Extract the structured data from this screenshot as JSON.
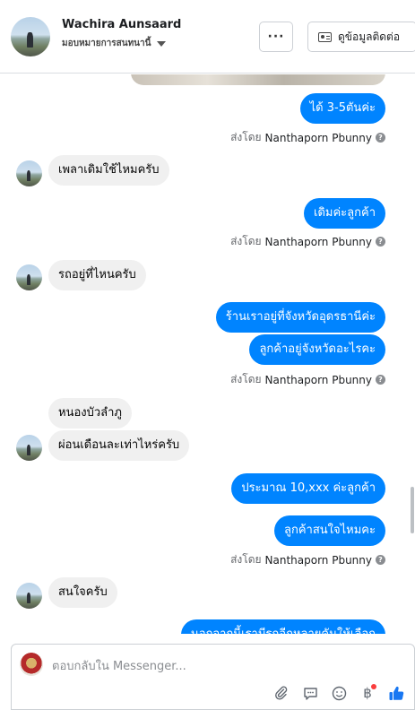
{
  "header": {
    "name": "Wachira Aunsaard",
    "assign_label": "มอบหมายการสนทนานี้",
    "more_label": "···",
    "contact_button": "ดูข้อมูลติดต่อ"
  },
  "messages": [
    {
      "type": "out",
      "text": "ได้ 3-5ตันค่ะ"
    },
    {
      "type": "in",
      "text": "เพลาเดิมใช้ไหมครับ"
    },
    {
      "type": "out",
      "text": "เดิมค่ะลูกค้า"
    },
    {
      "type": "in",
      "text": "รถอยู่ที่ไหนครับ"
    },
    {
      "type": "out",
      "text": "ร้านเราอยู่ที่จังหวัดอุดรธานีค่ะ"
    },
    {
      "type": "out",
      "text": "ลูกค้าอยู่จังหวัดอะไรคะ"
    },
    {
      "type": "in",
      "text": "หนองบัวลำภู"
    },
    {
      "type": "in",
      "text": "ผ่อนเดือนละเท่าไหร่ครับ"
    },
    {
      "type": "out",
      "text": "ประมาณ 10,xxx ค่ะลูกค้า"
    },
    {
      "type": "out",
      "text": "ลูกค้าสนใจไหมคะ"
    },
    {
      "type": "in",
      "text": "สนใจครับ"
    },
    {
      "type": "out",
      "text": "นอกจากนี้เรามีรถอีกหลายคันให้เลือก"
    }
  ],
  "sent_by": {
    "prefix": "ส่งโดย",
    "agent": "Nanthaporn Pbunny"
  },
  "composer": {
    "placeholder": "ตอบกลับใน Messenger..."
  },
  "icons": [
    "attach-icon",
    "sticker-icon",
    "emoji-icon",
    "baht-payment-icon",
    "thumbs-up-icon"
  ],
  "colors": {
    "outgoing_bubble": "#0084ff",
    "incoming_bubble": "#f0f0f0",
    "like_button": "#1877f2"
  }
}
